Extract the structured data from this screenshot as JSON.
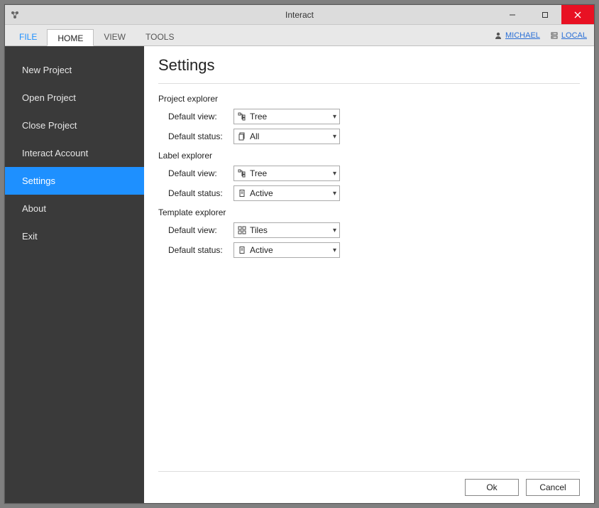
{
  "window": {
    "title": "Interact"
  },
  "ribbon": {
    "tabs": {
      "file": "FILE",
      "home": "HOME",
      "view": "VIEW",
      "tools": "TOOLS"
    },
    "user_link": "MICHAEL",
    "location_link": "LOCAL"
  },
  "sidebar": {
    "items": [
      "New Project",
      "Open Project",
      "Close Project",
      "Interact Account",
      "Settings",
      "About",
      "Exit"
    ],
    "selected_index": 4
  },
  "settings": {
    "title": "Settings",
    "sections": {
      "project_explorer": {
        "heading": "Project explorer",
        "default_view_label": "Default view:",
        "default_view_value": "Tree",
        "default_status_label": "Default status:",
        "default_status_value": "All"
      },
      "label_explorer": {
        "heading": "Label explorer",
        "default_view_label": "Default view:",
        "default_view_value": "Tree",
        "default_status_label": "Default status:",
        "default_status_value": "Active"
      },
      "template_explorer": {
        "heading": "Template explorer",
        "default_view_label": "Default view:",
        "default_view_value": "Tiles",
        "default_status_label": "Default status:",
        "default_status_value": "Active"
      }
    },
    "buttons": {
      "ok": "Ok",
      "cancel": "Cancel"
    }
  }
}
